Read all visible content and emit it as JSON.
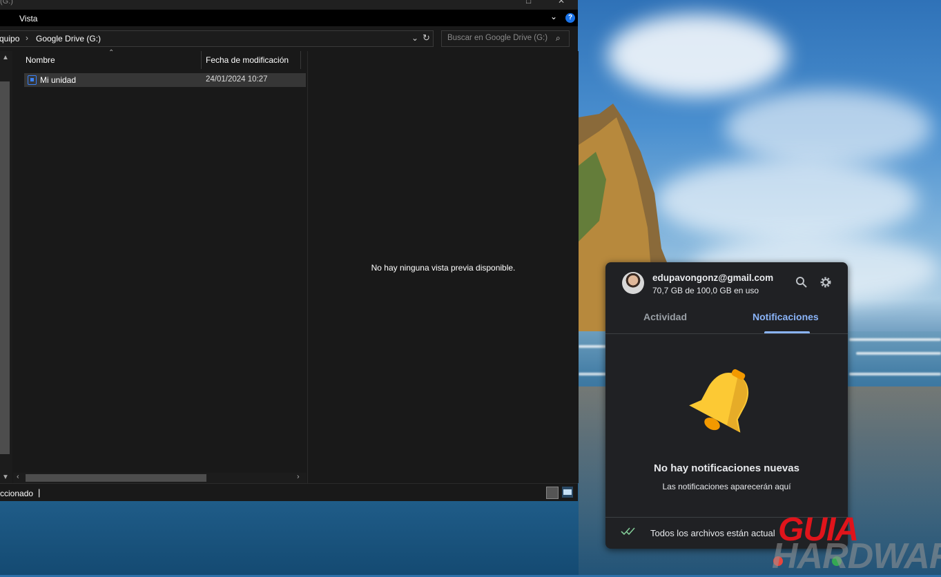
{
  "window": {
    "title_fragment": "(G:)",
    "ribbon_tab": "Vista",
    "help_label": "?"
  },
  "address": {
    "segment_1": "quipo",
    "segment_2": "Google Drive (G:)",
    "search_placeholder": "Buscar en Google Drive (G:)"
  },
  "file_list": {
    "columns": [
      "Nombre",
      "Fecha de modificación"
    ],
    "rows": [
      {
        "name": "Mi unidad",
        "modified": "24/01/2024 10:27"
      }
    ]
  },
  "preview": {
    "message": "No hay ninguna vista previa disponible."
  },
  "statusbar": {
    "text": "ccionado",
    "cursor": "|"
  },
  "drive_panel": {
    "email": "edupavongonz@gmail.com",
    "quota": "70,7 GB de 100,0 GB en uso",
    "tabs": [
      "Actividad",
      "Notificaciones"
    ],
    "active_tab": "Notificaciones",
    "empty_title": "No hay notificaciones nuevas",
    "empty_subtitle": "Las notificaciones aparecerán aquí",
    "sync_status": "Todos los archivos están actual",
    "accent_color": "#8ab4f8",
    "bell_color": "#fcc934"
  },
  "watermark": {
    "line_1": "GUIA",
    "line_2": "HARDWARE"
  }
}
